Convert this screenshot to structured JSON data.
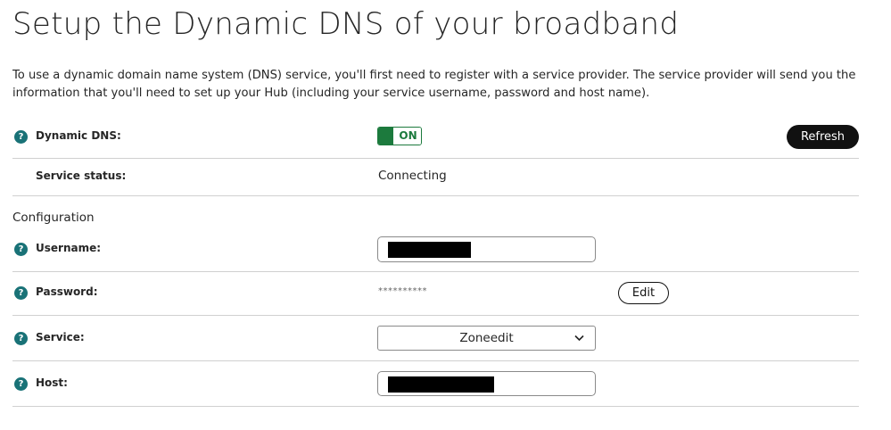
{
  "page": {
    "title": "Setup the Dynamic DNS of your broadband",
    "intro": "To use a dynamic domain name system (DNS) service, you'll first need to register with a service provider. The service provider will send you the information that you'll need to set up your Hub (including your service username, password and host name)."
  },
  "dynamic_dns": {
    "label": "Dynamic DNS:",
    "toggle_state": "ON",
    "refresh_label": "Refresh"
  },
  "service_status": {
    "label": "Service status:",
    "value": "Connecting"
  },
  "configuration": {
    "heading": "Configuration",
    "username": {
      "label": "Username:",
      "value": ""
    },
    "password": {
      "label": "Password:",
      "masked_value": "**********",
      "edit_label": "Edit"
    },
    "service": {
      "label": "Service:",
      "selected": "Zoneedit"
    },
    "host": {
      "label": "Host:",
      "value": ""
    }
  },
  "icons": {
    "help": "help-circle-icon",
    "chevron": "chevron-down-icon"
  },
  "colors": {
    "help_icon": "#197277",
    "toggle_on": "#1c7a3d",
    "primary_button": "#111111"
  }
}
